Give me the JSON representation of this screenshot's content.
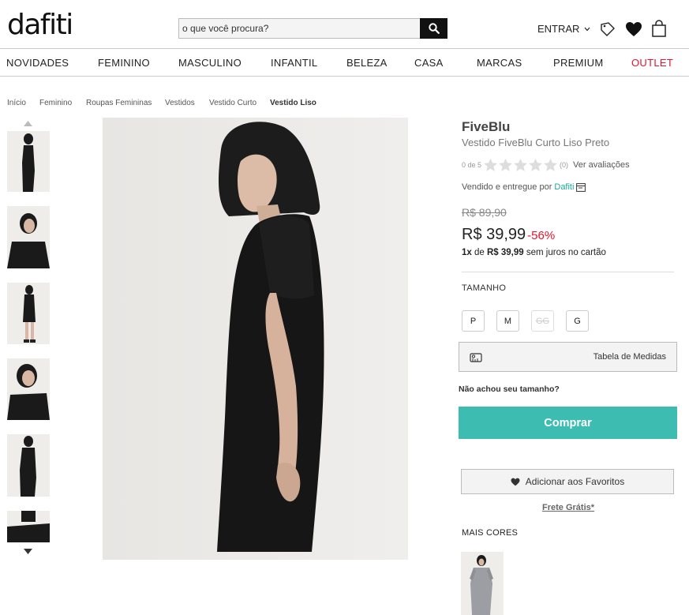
{
  "header": {
    "logo": "dafiti",
    "search_placeholder": "o que você procura?",
    "entrar": "ENTRAR"
  },
  "nav": [
    {
      "label": "NOVIDADES"
    },
    {
      "label": "FEMININO"
    },
    {
      "label": "MASCULINO"
    },
    {
      "label": "INFANTIL"
    },
    {
      "label": "BELEZA"
    },
    {
      "label": "CASA"
    },
    {
      "label": "MARCAS"
    },
    {
      "label": "PREMIUM"
    },
    {
      "label": "OUTLET"
    }
  ],
  "breadcrumb": [
    "Início",
    "Feminino",
    "Roupas Femininas",
    "Vestidos",
    "Vestido Curto",
    "Vestido Liso"
  ],
  "product": {
    "brand": "FiveBlu",
    "name": "Vestido FiveBlu Curto Liso Preto",
    "rating_text": "0 de 5",
    "rating_count": "(0)",
    "rating_link": "Ver avaliações",
    "sold_by_prefix": "Vendido e entregue por",
    "seller": "Dafiti",
    "old_price": "R$ 89,90",
    "price": "R$ 39,99",
    "discount": "-56%",
    "installment_prefix": "1x",
    "installment_mid": "de",
    "installment_value": "R$ 39,99",
    "installment_suffix": "sem juros no cartão"
  },
  "sizes": {
    "label": "TAMANHO",
    "options": [
      {
        "label": "P",
        "available": true
      },
      {
        "label": "M",
        "available": true
      },
      {
        "label": "GG",
        "available": false
      },
      {
        "label": "G",
        "available": true
      }
    ]
  },
  "actions": {
    "size_chart": "Tabela de Medidas",
    "size_not_found": "Não achou seu tamanho?",
    "buy": "Comprar",
    "favorite": "Adicionar aos Favoritos",
    "shipping": "Frete Grátis*"
  },
  "more_colors": {
    "label": "MAIS CORES"
  },
  "colors": {
    "accent": "#3dbdb1",
    "outlet": "#e8112d",
    "discount": "#e8112d",
    "seller": "#1aa99a"
  }
}
